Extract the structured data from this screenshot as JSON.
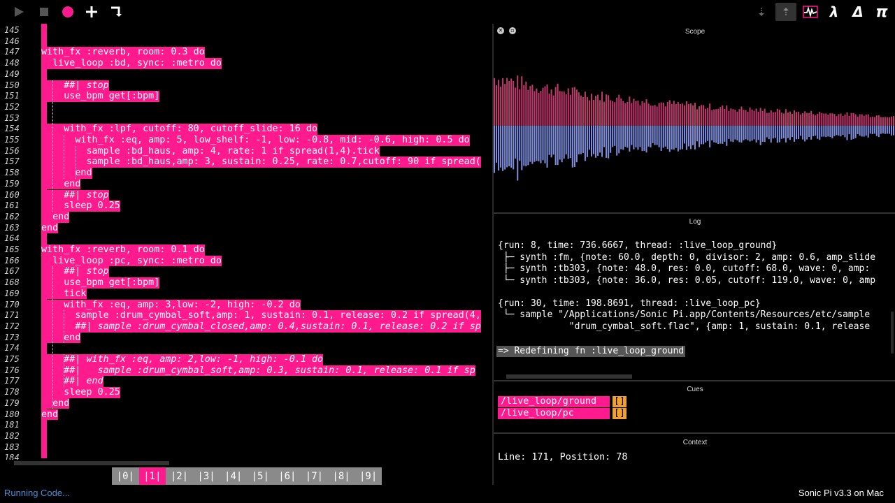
{
  "toolbar": {
    "left_icons": [
      "play-icon",
      "stop-icon",
      "record-icon",
      "plus-icon",
      "corner-arrow-icon"
    ],
    "right_icons": [
      "down-arrow-icon",
      "up-arrow-icon",
      "scope-icon"
    ],
    "lambda": "λ",
    "delta": "Δ",
    "pi": "π",
    "colors": {
      "accent": "#ff1b8d",
      "active_bg": "#333333"
    }
  },
  "editor": {
    "line_numbers": [
      "145",
      "146",
      "147",
      "148",
      "149",
      "150",
      "151",
      "152",
      "153",
      "154",
      "155",
      "156",
      "157",
      "158",
      "159",
      "160",
      "161",
      "162",
      "163",
      "164",
      "165",
      "166",
      "167",
      "168",
      "169",
      "170",
      "171",
      "172",
      "173",
      "174",
      "175",
      "176",
      "177",
      "178",
      "179",
      "180",
      "181",
      "182",
      "183",
      "184"
    ],
    "lines": [
      {
        "text": "",
        "hl": false
      },
      {
        "text": "",
        "hl": false
      },
      {
        "text": "with_fx :reverb, room: 0.3 do",
        "hl": true
      },
      {
        "text": "  live_loop :bd, sync: :metro do",
        "hl": true
      },
      {
        "text": "",
        "hl": false
      },
      {
        "text": "    ##| stop",
        "hl": true,
        "comment": true
      },
      {
        "text": "    use_bpm get[:bpm]",
        "hl": true
      },
      {
        "text": "",
        "hl": false
      },
      {
        "text": "",
        "hl": false
      },
      {
        "text": "    with_fx :lpf, cutoff: 80, cutoff_slide: 16 do",
        "hl": true
      },
      {
        "text": "      with_fx :eq, amp: 5, low_shelf: -1, low: -0.8, mid: -0.6, high: 0.5 do",
        "hl": true
      },
      {
        "text": "        sample :bd_haus, amp: 4, rate: 1 if spread(1,4).tick",
        "hl": true
      },
      {
        "text": "        sample :bd_haus,amp: 3, sustain: 0.25, rate: 0.7,cutoff: 90 if spread(",
        "hl": true
      },
      {
        "text": "      end",
        "hl": true
      },
      {
        "text": "    end",
        "hl": true
      },
      {
        "text": "    ##| stop",
        "hl": true,
        "comment": true
      },
      {
        "text": "    sleep 0.25",
        "hl": true
      },
      {
        "text": "  end",
        "hl": true
      },
      {
        "text": "end",
        "hl": true
      },
      {
        "text": "",
        "hl": false
      },
      {
        "text": "with_fx :reverb, room: 0.1 do",
        "hl": true
      },
      {
        "text": "  live_loop :pc, sync: :metro do",
        "hl": true
      },
      {
        "text": "    ##| stop",
        "hl": true,
        "comment": true
      },
      {
        "text": "    use_bpm get[:bpm]",
        "hl": true
      },
      {
        "text": "    tick",
        "hl": true
      },
      {
        "text": "    with_fx :eq, amp: 3,low: -2, high: -0.2 do",
        "hl": true
      },
      {
        "text": "      sample :drum_cymbal_soft,amp: 1, sustain: 0.1, release: 0.2 if spread(4,",
        "hl": true
      },
      {
        "text": "      ##| sample :drum_cymbal_closed,amp: 0.4,sustain: 0.1, release: 0.2 if sp",
        "hl": true,
        "comment": true
      },
      {
        "text": "    end",
        "hl": true
      },
      {
        "text": "",
        "hl": false
      },
      {
        "text": "    ##| with_fx :eq, amp: 2,low: -1, high: -0.1 do",
        "hl": true,
        "comment": true
      },
      {
        "text": "    ##|   sample :drum_cymbal_soft,amp: 0.3, sustain: 0.1, release: 0.1 if sp",
        "hl": true,
        "comment": true
      },
      {
        "text": "    ##| end",
        "hl": true,
        "comment": true
      },
      {
        "text": "    sleep 0.25",
        "hl": true
      },
      {
        "text": "  end",
        "hl": true
      },
      {
        "text": "end",
        "hl": true
      },
      {
        "text": "",
        "hl": false
      },
      {
        "text": "",
        "hl": false
      },
      {
        "text": "",
        "hl": false
      },
      {
        "text": "",
        "hl": false
      }
    ]
  },
  "buffers": [
    "|0|",
    "|1|",
    "|2|",
    "|3|",
    "|4|",
    "|5|",
    "|6|",
    "|7|",
    "|8|",
    "|9|"
  ],
  "active_buffer": 1,
  "scope": {
    "title": "Scope",
    "close_glyph": "✕",
    "min_glyph": "▫",
    "colors": {
      "top": "#c03a6e",
      "bottom": "#7f8fe0"
    }
  },
  "log": {
    "title": "Log",
    "lines": [
      "{run: 8, time: 736.6667, thread: :live_loop_ground}",
      " ├─ synth :fm, {note: 60.0, depth: 0, divisor: 2, amp: 0.6, amp_slide",
      " ├─ synth :tb303, {note: 48.0, res: 0.0, cutoff: 68.0, wave: 0, amp:",
      " └─ synth :tb303, {note: 36.0, res: 0.05, cutoff: 119.0, wave: 0, amp",
      "",
      "{run: 30, time: 198.8691, thread: :live_loop_pc}",
      " └─ sample \"/Applications/Sonic Pi.app/Contents/Resources/etc/sample",
      "             \"drum_cymbal_soft.flac\", {amp: 1, sustain: 0.1, release"
    ],
    "redefine": "=> Redefining fn :live_loop_ground"
  },
  "cues": {
    "title": "Cues",
    "items": [
      {
        "path": "/live_loop/ground",
        "args": "[]"
      },
      {
        "path": "/live_loop/pc",
        "args": "[]"
      }
    ]
  },
  "context": {
    "title": "Context",
    "text": "Line: 171,  Position: 78"
  },
  "status": {
    "left": "Running Code...",
    "right": "Sonic Pi v3.3 on Mac"
  }
}
